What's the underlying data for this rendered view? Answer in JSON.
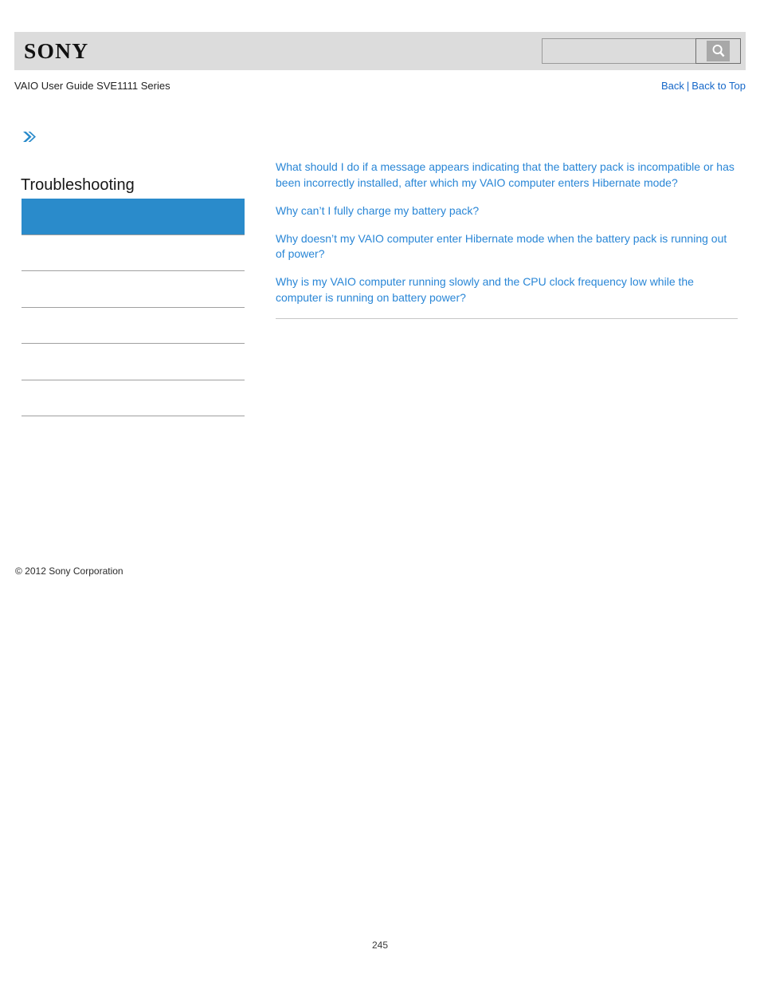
{
  "header": {
    "logo_text": "SONY",
    "search": {
      "value": "",
      "placeholder": "",
      "icon": "search-icon",
      "button_label": ""
    }
  },
  "subheader": {
    "guide_title": "VAIO User Guide SVE1111 Series",
    "links": [
      {
        "label": "Back"
      },
      {
        "label": "Back to Top"
      }
    ],
    "separator": "|"
  },
  "sidebar": {
    "breadcrumb_icon": "double-chevron-right-icon",
    "page_title": "Troubleshooting",
    "items": [
      {
        "label": "",
        "selected": true
      },
      {
        "label": "",
        "selected": false
      },
      {
        "label": "",
        "selected": false
      },
      {
        "label": "",
        "selected": false
      },
      {
        "label": "",
        "selected": false
      },
      {
        "label": "",
        "selected": false
      }
    ]
  },
  "main": {
    "faq_links": [
      {
        "label": "What should I do if a message appears indicating that the battery pack is incompatible or has been incorrectly installed, after which my VAIO computer enters Hibernate mode?"
      },
      {
        "label": "Why can’t I fully charge my battery pack?"
      },
      {
        "label": "Why doesn’t my VAIO computer enter Hibernate mode when the battery pack is running out of power?"
      },
      {
        "label": "Why is my VAIO computer running slowly and the CPU clock frequency low while the computer is running on battery power?"
      }
    ]
  },
  "footer": {
    "copyright": "© 2012 Sony Corporation",
    "page_number": "245"
  },
  "colors": {
    "header_band": "#dcdcdc",
    "accent_blue": "#2a8bcb",
    "link_blue": "#2986d6",
    "nav_link_blue": "#1567c8",
    "rule_gray": "#a0a0a0"
  }
}
